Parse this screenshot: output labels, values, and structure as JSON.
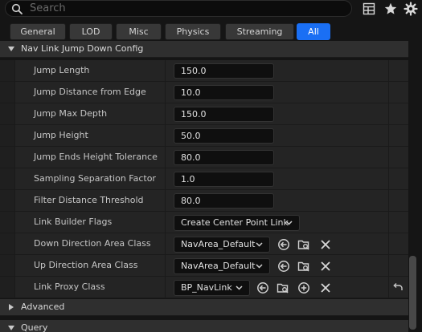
{
  "search": {
    "placeholder": "Search"
  },
  "toolbar": {
    "icons": [
      "table-view-icon",
      "favorites-star-icon",
      "settings-gear-icon"
    ]
  },
  "filters": [
    "General",
    "LOD",
    "Misc",
    "Physics",
    "Streaming",
    "All"
  ],
  "active_filter": "All",
  "section": {
    "title": "Nav Link Jump Down Config"
  },
  "properties": [
    {
      "label": "Jump Length",
      "value": "150.0"
    },
    {
      "label": "Jump Distance from Edge",
      "value": "10.0"
    },
    {
      "label": "Jump Max Depth",
      "value": "150.0"
    },
    {
      "label": "Jump Height",
      "value": "50.0"
    },
    {
      "label": "Jump Ends Height Tolerance",
      "value": "80.0"
    },
    {
      "label": "Sampling Separation Factor",
      "value": "1.0"
    },
    {
      "label": "Filter Distance Threshold",
      "value": "80.0"
    },
    {
      "label": "Link Builder Flags",
      "value": "Create Center Point Link"
    },
    {
      "label": "Down Direction Area Class",
      "value": "NavArea_Default"
    },
    {
      "label": "Up Direction Area Class",
      "value": "NavArea_Default"
    },
    {
      "label": "Link Proxy Class",
      "value": "BP_NavLink"
    }
  ],
  "categories": {
    "advanced": "Advanced",
    "query": "Query"
  },
  "colors": {
    "accent": "#1a6ff4",
    "panel_bg": "#242424",
    "field_bg": "#0f0f0f"
  }
}
